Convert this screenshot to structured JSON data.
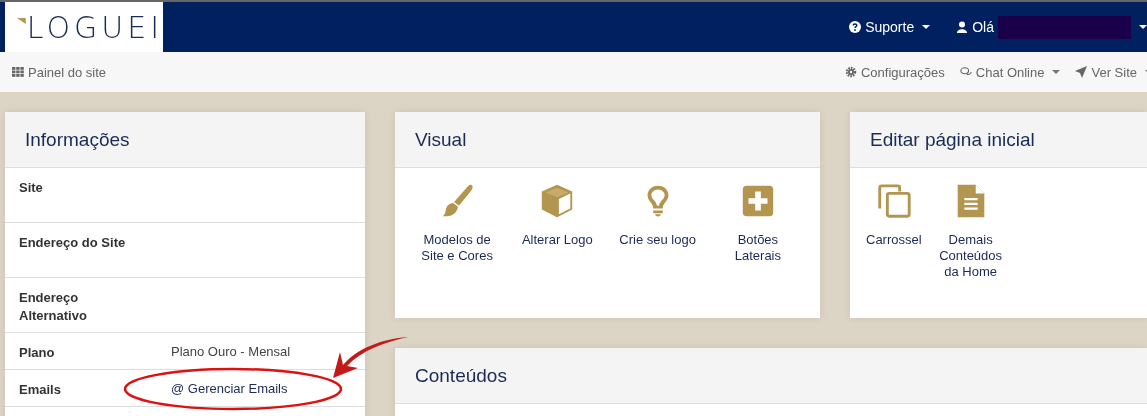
{
  "navbar": {
    "logo": "LOGUEI",
    "menus": [
      {
        "kind": "help",
        "label": "Suporte"
      },
      {
        "kind": "user",
        "label": "Olá"
      }
    ]
  },
  "subbar": {
    "title": "Painel do site",
    "links": [
      {
        "kind": "settings",
        "label": "Configurações",
        "dropdown": false
      },
      {
        "kind": "chat",
        "label": "Chat Online",
        "dropdown": true
      },
      {
        "kind": "rocket",
        "label": "Ver Site",
        "dropdown": true
      }
    ]
  },
  "info": {
    "title": "Informações",
    "rows": [
      {
        "label": "Site",
        "value": "",
        "kind": "text"
      },
      {
        "label": "Endereço do Site",
        "value": "",
        "kind": "text"
      },
      {
        "label": "Endereço Alternativo",
        "value": "",
        "kind": "text"
      },
      {
        "label": "Plano",
        "value": "Plano Ouro - Mensal",
        "kind": "text"
      },
      {
        "label": "Emails",
        "value": "@ Gerenciar Emails",
        "kind": "link"
      }
    ]
  },
  "visual": {
    "title": "Visual",
    "items": [
      {
        "kind": "brush",
        "label": "Modelos de Site e Cores"
      },
      {
        "kind": "cube",
        "label": "Alterar Logo"
      },
      {
        "kind": "bulb",
        "label": "Crie seu logo"
      },
      {
        "kind": "plus",
        "label": "Botões Laterais"
      }
    ]
  },
  "home": {
    "title": "Editar página inicial",
    "items": [
      {
        "kind": "copy",
        "label": "Carrossel"
      },
      {
        "kind": "file",
        "label": "Demais Conteúdos da Home"
      }
    ]
  },
  "contents": {
    "title": "Conteúdos"
  }
}
